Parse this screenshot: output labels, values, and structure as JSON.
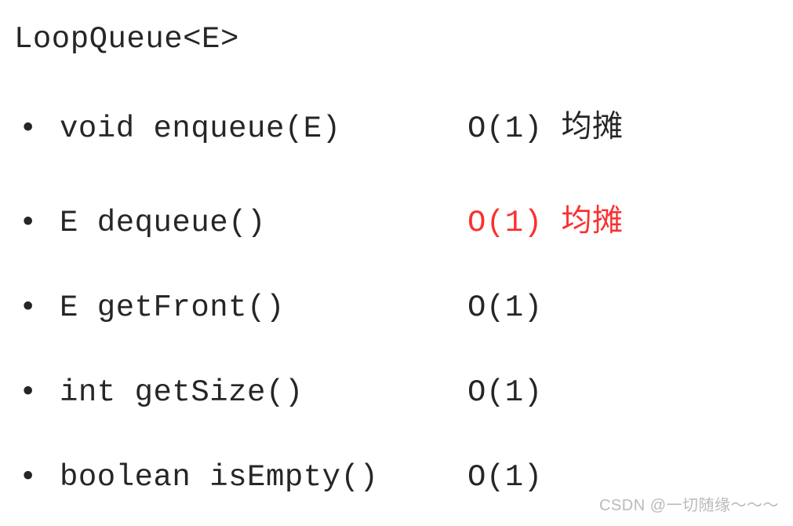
{
  "title": "LoopQueue<E>",
  "bullet": "•",
  "rows": [
    {
      "method": "void enqueue(E)",
      "complexity": "O(1) 均摊",
      "highlight": false
    },
    {
      "method": "E dequeue()",
      "complexity": "O(1) 均摊",
      "highlight": true
    },
    {
      "method": "E getFront()",
      "complexity": "O(1)",
      "highlight": false
    },
    {
      "method": "int getSize()",
      "complexity": "O(1)",
      "highlight": false
    },
    {
      "method": "boolean isEmpty()",
      "complexity": "O(1)",
      "highlight": false
    }
  ],
  "watermark": "CSDN @一切随缘～～～"
}
